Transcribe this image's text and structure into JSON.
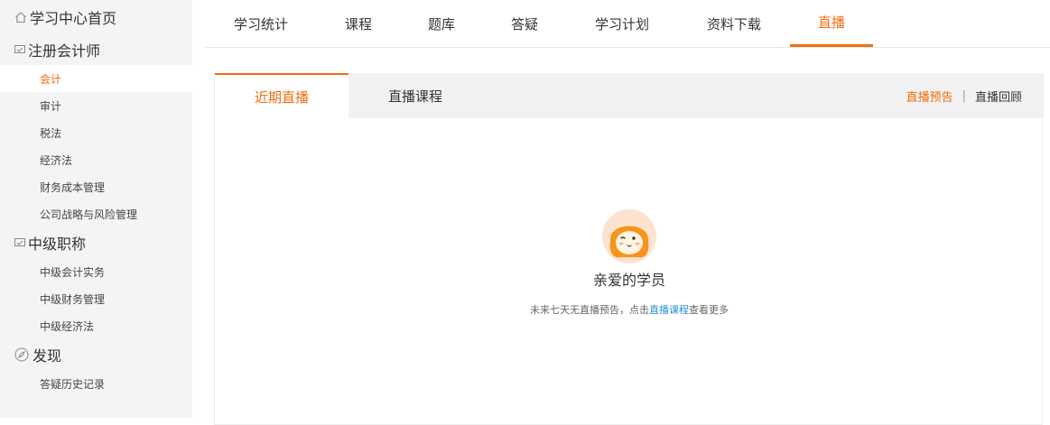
{
  "sidebar": {
    "home_label": "学习中心首页",
    "sections": [
      {
        "title": "注册会计师",
        "items": [
          "会计",
          "审计",
          "税法",
          "经济法",
          "财务成本管理",
          "公司战略与风险管理"
        ]
      },
      {
        "title": "中级职称",
        "items": [
          "中级会计实务",
          "中级财务管理",
          "中级经济法"
        ]
      },
      {
        "title": "发现",
        "items": [
          "答疑历史记录"
        ]
      }
    ]
  },
  "topnav": {
    "tabs": [
      "学习统计",
      "课程",
      "题库",
      "答疑",
      "学习计划",
      "资料下载",
      "直播"
    ],
    "active_index": 6
  },
  "subtabs": {
    "tabs": [
      "近期直播",
      "直播课程"
    ],
    "active_index": 0
  },
  "links": {
    "preview": "直播预告",
    "separator": "|",
    "replay": "直播回顾"
  },
  "empty_state": {
    "title": "亲爱的学员",
    "message_before": "未来七天无直播预告，点击",
    "link": "直播课程",
    "message_after": "查看更多"
  },
  "colors": {
    "accent": "#f26d10",
    "link_blue": "#2a8fd3",
    "sidebar_bg": "#f4f4f4",
    "subbar_bg": "#f2f2f2"
  },
  "icons": {
    "home": "home-icon",
    "section": "monitor-icon",
    "discover": "compass-icon",
    "mascot": "mascot-avatar"
  }
}
